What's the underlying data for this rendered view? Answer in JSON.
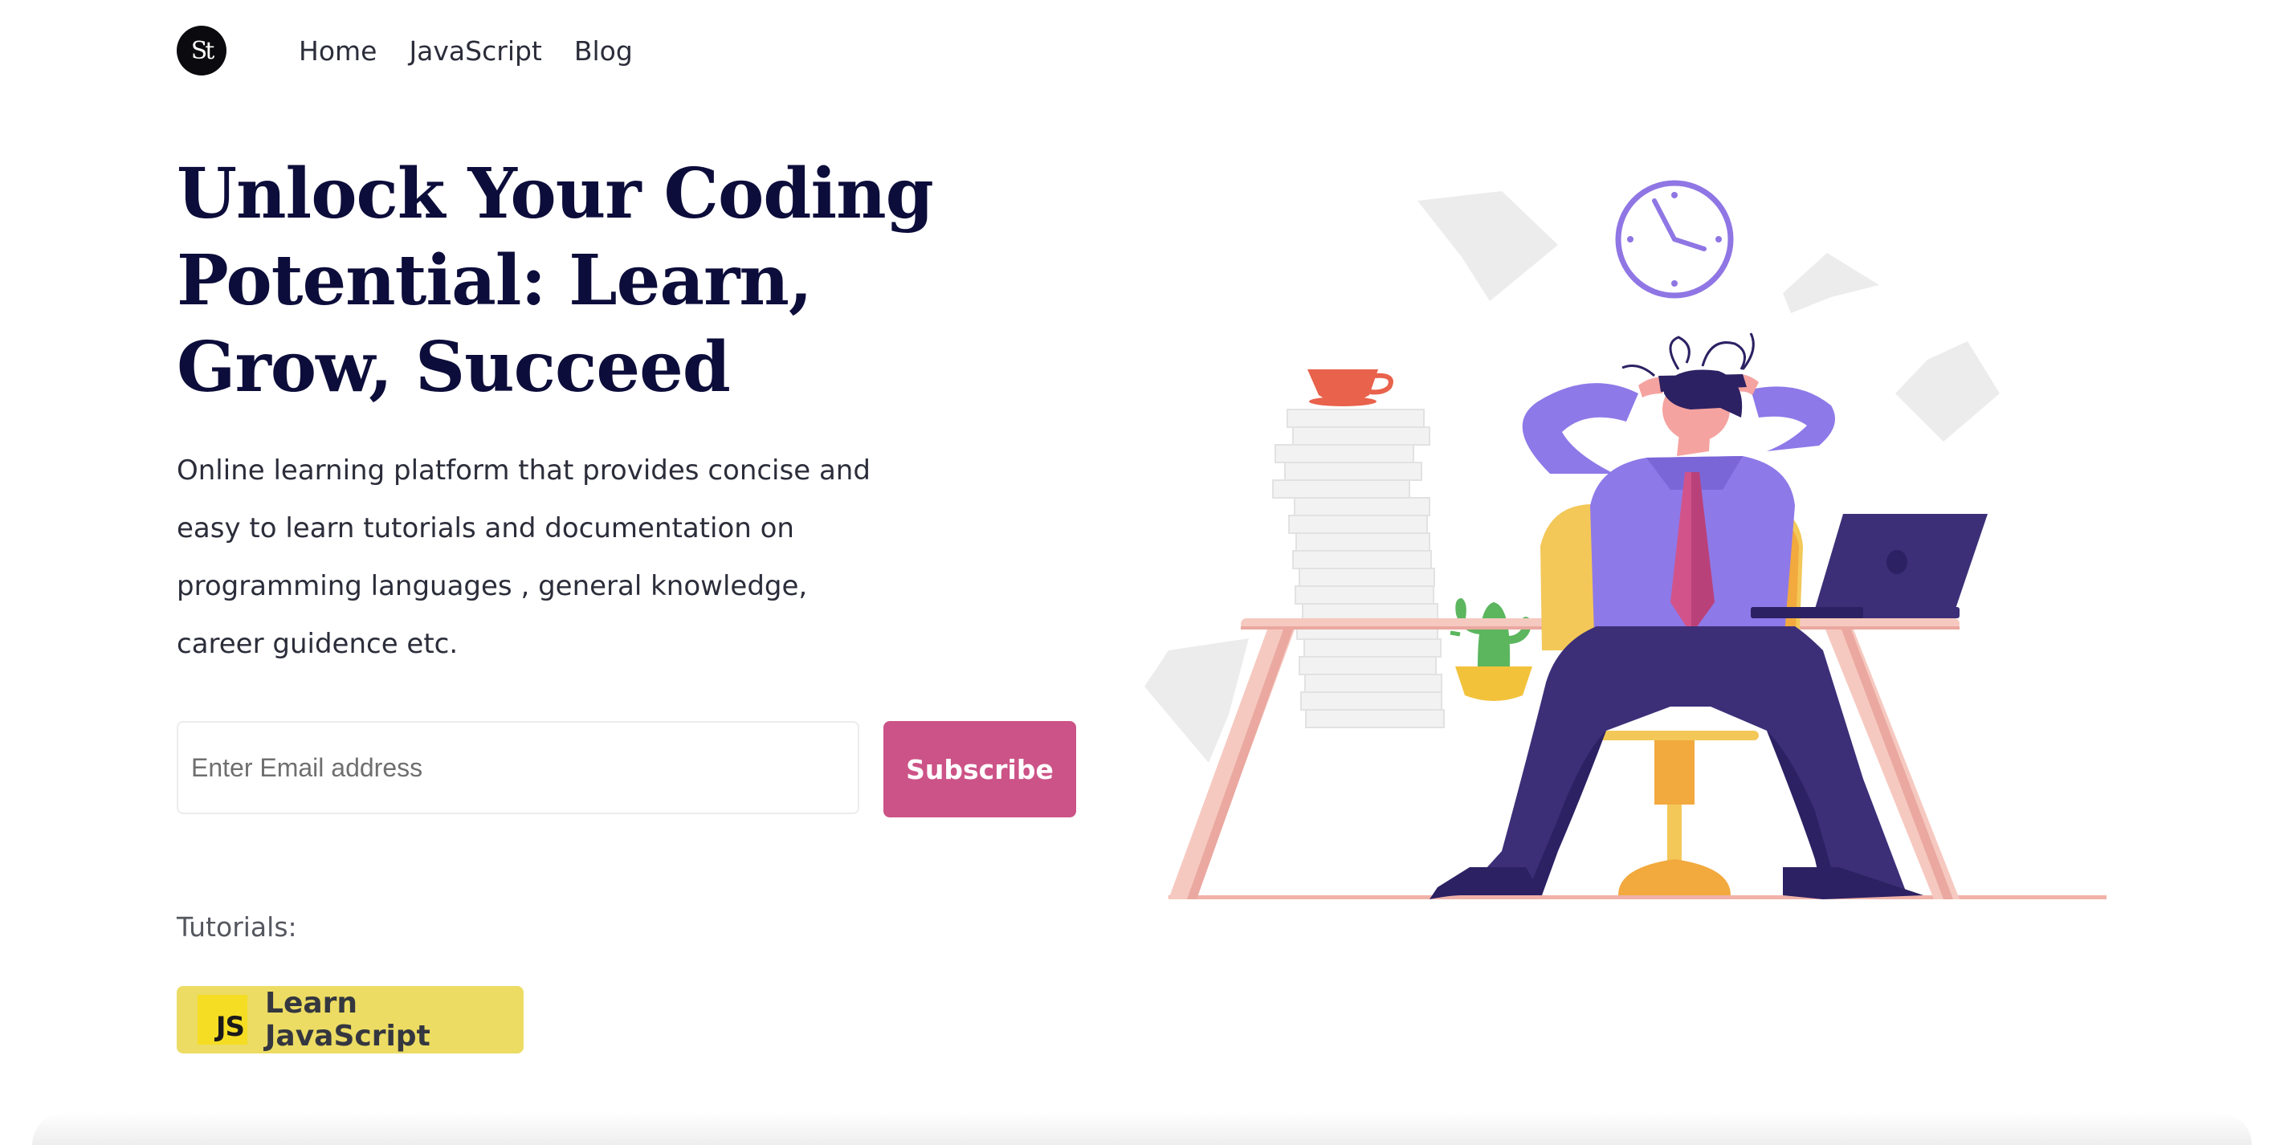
{
  "nav": {
    "logo_text": "St",
    "links": [
      "Home",
      "JavaScript",
      "Blog"
    ]
  },
  "hero": {
    "title": "Unlock Your Coding Potential: Learn, Grow, Succeed",
    "description": "Online learning platform that provides concise and easy to learn tutorials and documentation on programming languages , general knowledge, career guidence etc."
  },
  "subscribe": {
    "placeholder": "Enter Email address",
    "value": "",
    "button_label": "Subscribe"
  },
  "tutorials": {
    "label": "Tutorials:",
    "items": [
      {
        "icon_text": "JS",
        "label": "Learn JavaScript"
      }
    ]
  },
  "illustration": {
    "description_icon": "person-at-desk-stressed-illustration"
  },
  "colors": {
    "title": "#0d0d3b",
    "subscribe_button": "#cc5387",
    "tutorial_badge": "#ecdc63",
    "js_icon": "#f5dd23",
    "shirt": "#8e79e8",
    "pants": "#3c2f78"
  }
}
